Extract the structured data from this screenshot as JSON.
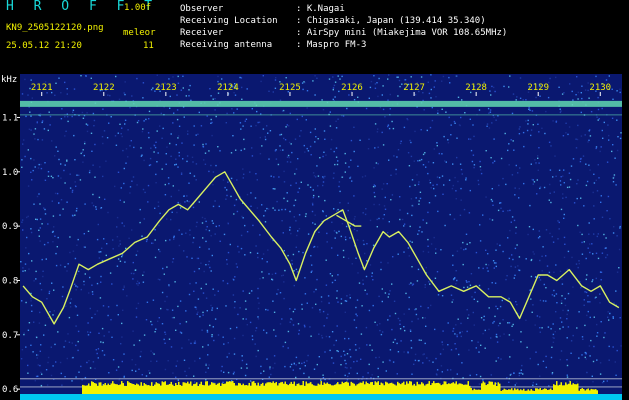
{
  "header": {
    "app_title": "H R O F F T",
    "version": "1.00f",
    "filename": "KN9_2505122120.png",
    "datetime": "25.05.12 21:20",
    "meleor_label": "meleor",
    "meleor_count": "11",
    "meta": [
      {
        "key": "Observer",
        "value": ": K.Nagai"
      },
      {
        "key": "Receiving Location",
        "value": ": Chigasaki, Japan (139.414 35.340)"
      },
      {
        "key": "Receiver",
        "value": ": AirSpy mini (Miakejima VOR 108.65MHz)"
      },
      {
        "key": "Receiving antenna",
        "value": ": Maspro FM-3"
      }
    ]
  },
  "colors": {
    "background": "#000000",
    "title": "#19d9d9",
    "labels": "#f2f200",
    "noise": "#1e3ca8",
    "trace": "#d8f060",
    "band": "#60d8b0",
    "meter": "#f2f200",
    "meter_base": "#00c8f0"
  },
  "chart_data": {
    "type": "line",
    "ylabel": "kHz",
    "x_ticks": [
      "2121",
      "2122",
      "2123",
      "2124",
      "2125",
      "2126",
      "2127",
      "2128",
      "2129",
      "2130"
    ],
    "y_ticks": [
      "1.1",
      "1.0",
      "0.9",
      "0.8",
      "0.7",
      "0.6"
    ],
    "ylim": [
      0.58,
      1.18
    ],
    "xlim": [
      2120.65,
      2130.35
    ],
    "carrier_khz": 1.125,
    "series": [
      {
        "x": [
          2120.7,
          2120.85,
          2121.0,
          2121.2,
          2121.35,
          2121.45,
          2121.6,
          2121.75,
          2121.9,
          2122.1,
          2122.3,
          2122.5,
          2122.7,
          2122.9,
          2123.05,
          2123.2,
          2123.35,
          2123.5,
          2123.65,
          2123.8,
          2123.95,
          2124.05,
          2124.2,
          2124.35,
          2124.5,
          2124.7,
          2124.85,
          2125.0,
          2125.1,
          2125.25,
          2125.4,
          2125.55,
          2125.7,
          2125.85,
          2125.95,
          2126.1,
          2126.2,
          2126.35,
          2126.5,
          2126.6,
          2126.75,
          2126.9,
          2127.05,
          2127.2,
          2127.4,
          2127.6,
          2127.8,
          2128.0,
          2128.2,
          2128.4,
          2128.55,
          2128.7,
          2128.85,
          2129.0,
          2129.15,
          2129.3,
          2129.5,
          2129.7,
          2129.85,
          2130.0,
          2130.15,
          2130.3
        ],
        "y": [
          0.79,
          0.77,
          0.76,
          0.72,
          0.75,
          0.78,
          0.83,
          0.82,
          0.83,
          0.84,
          0.85,
          0.87,
          0.88,
          0.91,
          0.93,
          0.94,
          0.93,
          0.95,
          0.97,
          0.99,
          1.0,
          0.98,
          0.95,
          0.93,
          0.91,
          0.88,
          0.86,
          0.83,
          0.8,
          0.85,
          0.89,
          0.91,
          0.92,
          0.93,
          0.9,
          0.85,
          0.82,
          0.86,
          0.89,
          0.88,
          0.89,
          0.87,
          0.84,
          0.81,
          0.78,
          0.79,
          0.78,
          0.79,
          0.77,
          0.77,
          0.76,
          0.73,
          0.77,
          0.81,
          0.81,
          0.8,
          0.82,
          0.79,
          0.78,
          0.79,
          0.76,
          0.75
        ]
      },
      {
        "x": [
          2125.75,
          2125.9,
          2126.05,
          2126.15
        ],
        "y": [
          0.92,
          0.91,
          0.9,
          0.9
        ]
      }
    ],
    "grid": false
  }
}
